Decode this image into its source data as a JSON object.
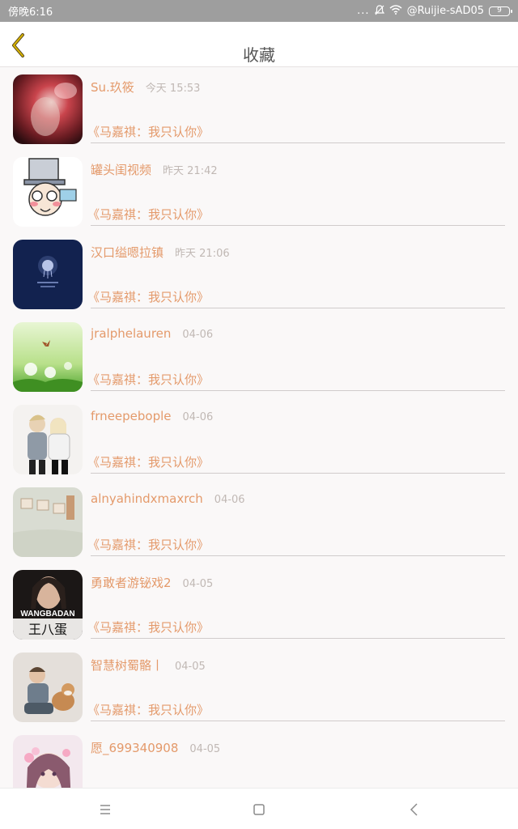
{
  "status_bar": {
    "time": "傍晚6:16",
    "dots": "...",
    "network": "@Ruijie-sAD05",
    "battery": "9"
  },
  "header": {
    "title": "收藏"
  },
  "favorites": [
    {
      "name": "Su.玖筱",
      "time": "今天 15:53",
      "song": "《马嘉祺：我只认你》",
      "thumb": "red-blurred-photo"
    },
    {
      "name": "罐头闺视频",
      "time": "昨天 21:42",
      "song": "《马嘉祺：我只认你》",
      "thumb": "cartoon-detective"
    },
    {
      "name": "汉口缢嗯拉镇",
      "time": "昨天 21:06",
      "song": "《马嘉祺：我只认你》",
      "thumb": "jellyfish-dark-blue"
    },
    {
      "name": "jralphelauren",
      "time": "04-06",
      "song": "《马嘉祺：我只认你》",
      "thumb": "dandelion-butterfly"
    },
    {
      "name": "frneepebople",
      "time": "04-06",
      "song": "《马嘉祺：我只认你》",
      "thumb": "couple-photo"
    },
    {
      "name": "alnyahindxmaxrch",
      "time": "04-06",
      "song": "《马嘉祺：我只认你》",
      "thumb": "love-letter-blocks"
    },
    {
      "name": "勇敢者游铋戏2",
      "time": "04-05",
      "song": "《马嘉祺：我只认你》",
      "thumb": "wangbadan-girl",
      "thumb_text_top": "WANGBADAN",
      "thumb_text_bottom": "王八蛋"
    },
    {
      "name": "智慧树蜀骼丨",
      "time": "04-05",
      "song": "《马嘉祺：我只认你》",
      "thumb": "child-with-dog"
    },
    {
      "name": "愿_699340908",
      "time": "04-05",
      "song": "",
      "thumb": "anime-girl-flowers"
    }
  ],
  "colors": {
    "accent": "#e49a6b",
    "timestamp": "#c0b8b4",
    "status_bar": "#9e9e9e",
    "back_icon": "#c9a400"
  },
  "nav": {
    "menu": "menu-icon",
    "home": "home-square-icon",
    "back": "back-chevron-icon"
  }
}
